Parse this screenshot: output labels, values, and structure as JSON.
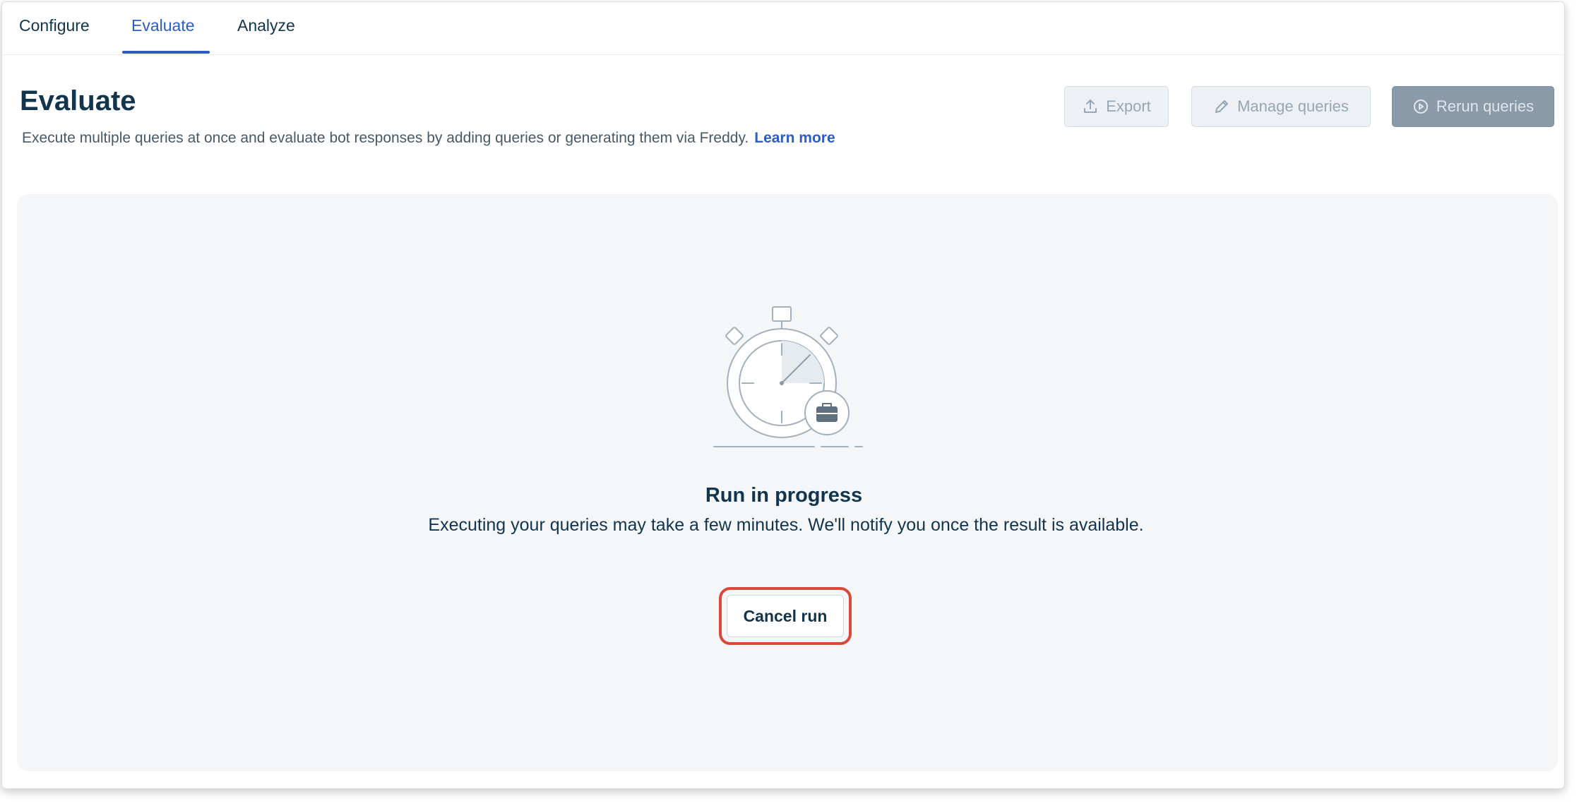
{
  "tabs": [
    {
      "label": "Configure",
      "active": false
    },
    {
      "label": "Evaluate",
      "active": true
    },
    {
      "label": "Analyze",
      "active": false
    }
  ],
  "header": {
    "title": "Evaluate",
    "description": "Execute multiple queries at once and evaluate bot responses by adding queries or generating them via Freddy.",
    "learn_more": "Learn more"
  },
  "toolbar": {
    "export_label": "Export",
    "manage_label": "Manage queries",
    "rerun_label": "Rerun queries",
    "export_icon": "upload-icon",
    "manage_icon": "pencil-icon",
    "rerun_icon": "play-circle-icon"
  },
  "status": {
    "illustration": "stopwatch-illustration",
    "title": "Run in progress",
    "message": "Executing your queries may take a few minutes. We'll notify you once the result is available.",
    "cancel_label": "Cancel run"
  },
  "colors": {
    "accent": "#2c5cc5",
    "text": "#12344d",
    "panel": "#f4f6f8",
    "highlight": "#d9483b"
  }
}
